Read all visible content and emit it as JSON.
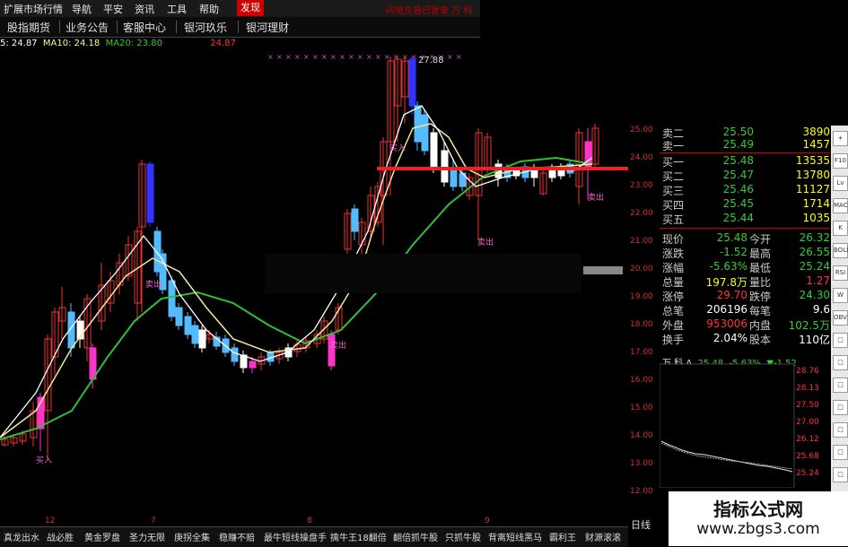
{
  "menu": {
    "items": [
      "扩展市场行情",
      "导航",
      "平安",
      "资讯",
      "工具",
      "帮助",
      "发现"
    ],
    "active": "发现",
    "alert": "闪电交易已登录  万  科"
  },
  "subnav": [
    "股指期货",
    "业务公告",
    "客服中心",
    "银河玖乐",
    "银河理财"
  ],
  "ma_line": {
    "ma5": "5: 24.87",
    "ma10": "MA10: 24.18",
    "ma20": "MA20: 23.80",
    "extra": "24.87"
  },
  "chart_data": {
    "type": "candlestick",
    "peak_label": "27.88",
    "sell_label": "卖出",
    "buy_label": "买入",
    "x_labels": [
      "12",
      "7",
      "8",
      "9"
    ]
  },
  "quote": {
    "sell2": {
      "label": "卖二",
      "price": "25.50",
      "vol": "3890"
    },
    "sell1": {
      "label": "卖一",
      "price": "25.49",
      "vol": "1457"
    },
    "buy1": {
      "label": "买一",
      "price": "25.48",
      "vol": "13535"
    },
    "buy2": {
      "label": "买二",
      "price": "25.47",
      "vol": "13780"
    },
    "buy3": {
      "label": "买三",
      "price": "25.46",
      "vol": "11127"
    },
    "buy4": {
      "label": "买四",
      "price": "25.45",
      "vol": "1714"
    },
    "buy5": {
      "label": "买五",
      "price": "25.44",
      "vol": "1035"
    },
    "rows": [
      {
        "l1": "现价",
        "v1": "25.48",
        "l2": "今开",
        "v2": "26.32",
        "c1": "#3c3",
        "c2": "#3c3"
      },
      {
        "l1": "涨跌",
        "v1": "-1.52",
        "l2": "最高",
        "v2": "26.55",
        "c1": "#3c3",
        "c2": "#3c3"
      },
      {
        "l1": "涨幅",
        "v1": "-5.63%",
        "l2": "最低",
        "v2": "25.24",
        "c1": "#3c3",
        "c2": "#3c3"
      },
      {
        "l1": "总量",
        "v1": "197.8万",
        "l2": "量比",
        "v2": "1.27",
        "c1": "#ff0",
        "c2": "#f33"
      },
      {
        "l1": "涨停",
        "v1": "29.70",
        "l2": "跌停",
        "v2": "24.30",
        "c1": "#f33",
        "c2": "#3c3"
      },
      {
        "l1": "总笔",
        "v1": "206196",
        "l2": "每笔",
        "v2": "9.6",
        "c1": "#fff",
        "c2": "#fff"
      },
      {
        "l1": "外盘",
        "v1": "953006",
        "l2": "内盘",
        "v2": "102.5万",
        "c1": "#f33",
        "c2": "#3c3"
      },
      {
        "l1": "换手",
        "v1": "2.04%",
        "l2": "股本",
        "v2": "110亿",
        "c1": "#fff",
        "c2": "#fff"
      }
    ]
  },
  "y_axis": [
    "25.00",
    "24.00",
    "23.00",
    "22.00",
    "21.00",
    "20.00",
    "19.00",
    "18.00",
    "17.00",
    "16.00",
    "15.00",
    "14.00",
    "13.00",
    "12.00"
  ],
  "mini": {
    "name": "万 科 A",
    "price": "25.48",
    "change": "-5.63%",
    "delta": "▼-1.52",
    "ticks": [
      "28.76",
      "28.13",
      "27.50",
      "27.00",
      "26.12",
      "25.68",
      "25.24"
    ]
  },
  "tabs": [
    "真龙出水",
    "战必胜",
    "黄金罗盘",
    "圣力无限",
    "庚拐全集",
    "稳赚不赔",
    "最牛短线操盘手",
    "擒牛王18翻倍",
    "翻倍抓牛股",
    "只抓牛股",
    "背离短线黑马",
    "霸利王",
    "财源滚滚"
  ],
  "right_tab": "日线",
  "toolbar_icons": [
    "+",
    "F10",
    "Lv",
    "MACD",
    "K",
    "BOLL",
    "RSI",
    "W",
    "OBV",
    "□",
    "□",
    "□",
    "□",
    "□",
    "□",
    "□"
  ],
  "logo": {
    "main": "指标公式网",
    "url": "www.zbgs3.com"
  }
}
